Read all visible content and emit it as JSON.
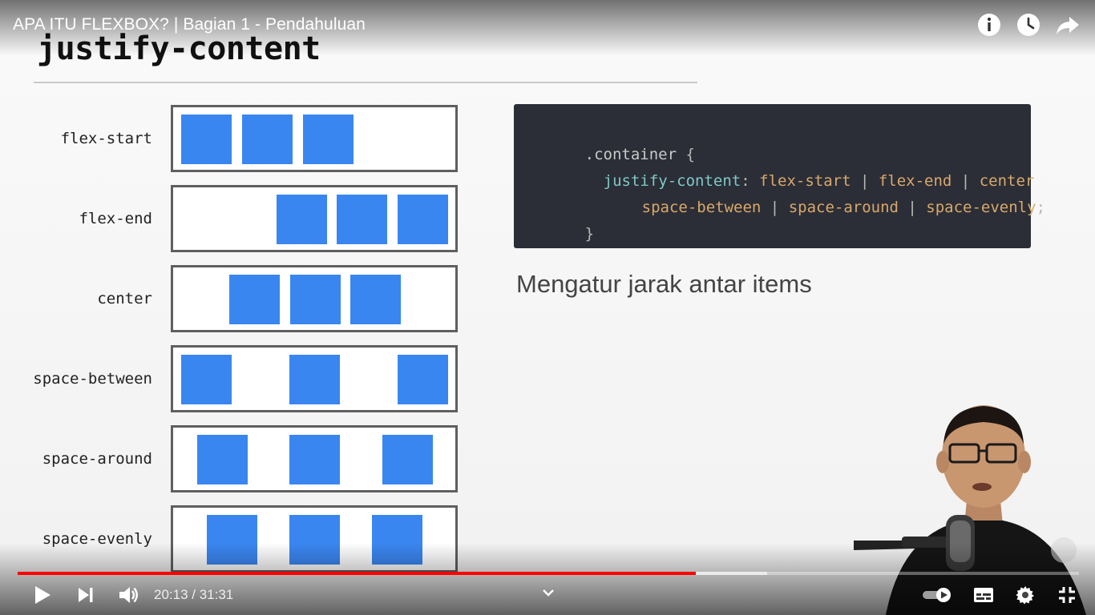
{
  "player": {
    "title": "APA ITU FLEXBOX? | Bagian 1 - Pendahuluan",
    "time_current": "20:13",
    "time_separator": " / ",
    "time_total": "31:31",
    "progress_fraction": 0.6388,
    "buffered_fraction": 0.7061,
    "accent_color": "#ff0000",
    "top_icons": [
      "info-icon",
      "watch-later-icon",
      "share-icon"
    ],
    "bottom_right_icons": [
      "autoplay-toggle-icon",
      "subtitles-icon",
      "settings-icon",
      "exit-fullscreen-icon"
    ]
  },
  "slide": {
    "heading": "justify-content",
    "rows": [
      {
        "label": "flex-start",
        "items_x": [
          10,
          86,
          162
        ]
      },
      {
        "label": "flex-end",
        "items_x": [
          129,
          204,
          280
        ]
      },
      {
        "label": "center",
        "items_x": [
          70,
          146,
          221
        ]
      },
      {
        "label": "space-between",
        "items_x": [
          10,
          145,
          280
        ]
      },
      {
        "label": "space-around",
        "items_x": [
          30,
          145,
          261
        ]
      },
      {
        "label": "space-evenly",
        "items_x": [
          42,
          145,
          248
        ]
      }
    ],
    "code": {
      "line1_selector": ".container",
      "line1_brace": " {",
      "line2_prop": "justify-content",
      "line2_colon": ": ",
      "v_flex_start": "flex-start",
      "v_flex_end": "flex-end",
      "v_center": "center",
      "v_space_between": "space-between",
      "v_space_around": "space-around",
      "v_space_evenly": "space-evenly",
      "sep": " | ",
      "semicolon": ";",
      "line4_brace": "}"
    },
    "description": "Mengatur jarak antar items",
    "item_color": "#3a86f0"
  }
}
